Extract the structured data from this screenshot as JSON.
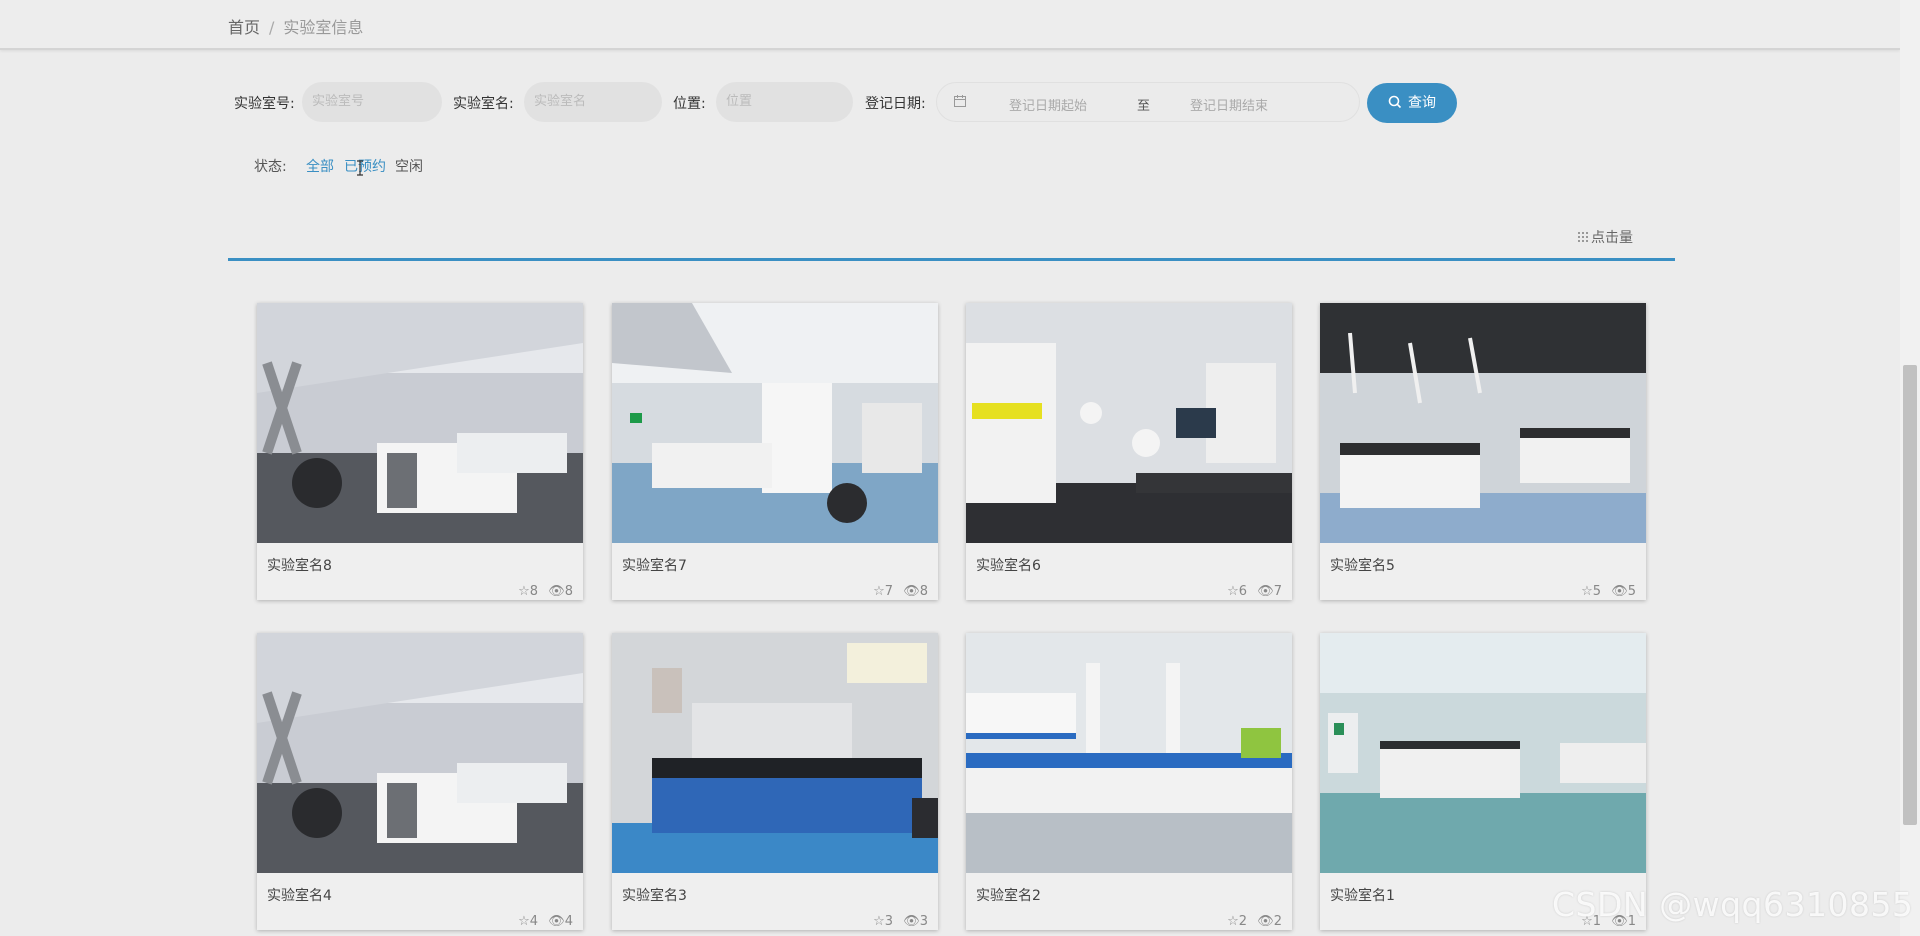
{
  "breadcrumb": {
    "home": "首页",
    "sep": "/",
    "current": "实验室信息"
  },
  "search": {
    "room_no_label": "实验室号:",
    "room_no_placeholder": "实验室号",
    "room_name_label": "实验室名:",
    "room_name_placeholder": "实验室名",
    "location_label": "位置:",
    "location_placeholder": "位置",
    "date_label": "登记日期:",
    "date_start_placeholder": "登记日期起始",
    "date_to": "至",
    "date_end_placeholder": "登记日期结束",
    "query_label": "查询"
  },
  "status": {
    "label": "状态:",
    "options": [
      "全部",
      "已预约",
      "空闲"
    ]
  },
  "sort": {
    "label": "点击量"
  },
  "cards": [
    {
      "title": "实验室名8",
      "stars": "8",
      "views": "8"
    },
    {
      "title": "实验室名7",
      "stars": "7",
      "views": "8"
    },
    {
      "title": "实验室名6",
      "stars": "6",
      "views": "7"
    },
    {
      "title": "实验室名5",
      "stars": "5",
      "views": "5"
    },
    {
      "title": "实验室名4",
      "stars": "4",
      "views": "4"
    },
    {
      "title": "实验室名3",
      "stars": "3",
      "views": "3"
    },
    {
      "title": "实验室名2",
      "stars": "2",
      "views": "2"
    },
    {
      "title": "实验室名1",
      "stars": "1",
      "views": "1"
    }
  ],
  "watermark": "CSDN @wqq6310855",
  "colors": {
    "accent": "#3a8fc3",
    "background": "#ececec"
  }
}
